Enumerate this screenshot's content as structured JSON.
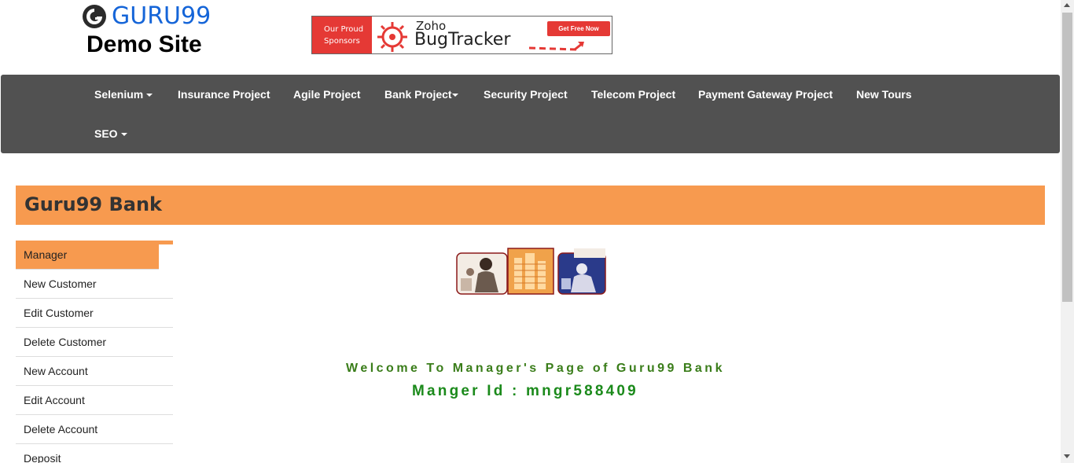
{
  "header": {
    "logo_text": "GURU99",
    "subtitle": "Demo Site"
  },
  "banner": {
    "left_line1": "Our Proud",
    "left_line2": "Sponsors",
    "brand_small": "Zoho",
    "brand_big": "BugTracker",
    "cta": "Get Free Now"
  },
  "nav": {
    "items": [
      {
        "label": "Selenium",
        "caret": true
      },
      {
        "label": "Insurance Project",
        "caret": false
      },
      {
        "label": "Agile Project",
        "caret": false
      },
      {
        "label": "Bank Project",
        "caret": true
      },
      {
        "label": "Security Project",
        "caret": false
      },
      {
        "label": "Telecom Project",
        "caret": false
      },
      {
        "label": "Payment Gateway Project",
        "caret": false
      },
      {
        "label": "New Tours",
        "caret": false
      },
      {
        "label": "SEO",
        "caret": true
      }
    ]
  },
  "bank": {
    "title": "Guru99 Bank"
  },
  "sidebar": {
    "items": [
      {
        "label": "Manager",
        "active": true
      },
      {
        "label": "New Customer",
        "active": false
      },
      {
        "label": "Edit Customer",
        "active": false
      },
      {
        "label": "Delete Customer",
        "active": false
      },
      {
        "label": "New Account",
        "active": false
      },
      {
        "label": "Edit Account",
        "active": false
      },
      {
        "label": "Delete Account",
        "active": false
      },
      {
        "label": "Deposit",
        "active": false
      }
    ]
  },
  "main": {
    "welcome": "Welcome To Manager's Page of Guru99 Bank",
    "manager_id": "Manger Id : mngr588409"
  },
  "colors": {
    "accent": "#f79a4f",
    "navbar": "#515151",
    "welcome_green": "#3a7d1a",
    "id_green": "#1b8a1b",
    "logo_blue": "#1565d8"
  }
}
